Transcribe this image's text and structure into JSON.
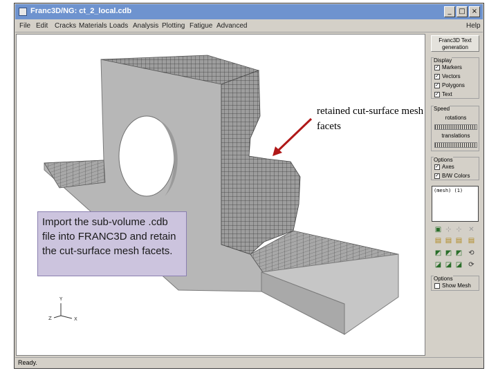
{
  "window": {
    "title": "Franc3D/NG: ct_2_local.cdb",
    "minimize_label": "_",
    "maximize_label": "□",
    "close_label": "×"
  },
  "menu": {
    "file": "File",
    "edit": "Edit",
    "cracks": "Cracks",
    "materials": "Materials",
    "loads": "Loads",
    "analysis": "Analysis",
    "plotting": "Plotting",
    "fatigue": "Fatigue",
    "advanced": "Advanced",
    "help": "Help"
  },
  "panel": {
    "franc_button": "Franc3D Text generation",
    "display": {
      "title": "Display",
      "markers": "Markers",
      "vectors": "Vectors",
      "polygons": "Polygons",
      "text": "Text"
    },
    "speed": {
      "title": "Speed",
      "rotations": "rotations",
      "translations": "translations"
    },
    "options": {
      "title": "Options",
      "axes": "Axes",
      "bw_colors": "B/W Colors"
    },
    "mesh_list": "(mesh) (1)",
    "options2": {
      "title": "Options",
      "show_mesh": "Show Mesh"
    }
  },
  "axes_labels": {
    "y": "Y",
    "x": "X",
    "z": "Z"
  },
  "status": {
    "text": "Ready."
  },
  "annotations": {
    "note": "Import the sub-volume .cdb file into FRANC3D and retain the cut-surface mesh facets.",
    "callout": "retained cut-surface mesh facets"
  },
  "colors": {
    "titlebar": "#6e93cf",
    "note_bg": "#ccc4de",
    "arrow": "#b01818",
    "model_gray": "#b7b7b7"
  }
}
